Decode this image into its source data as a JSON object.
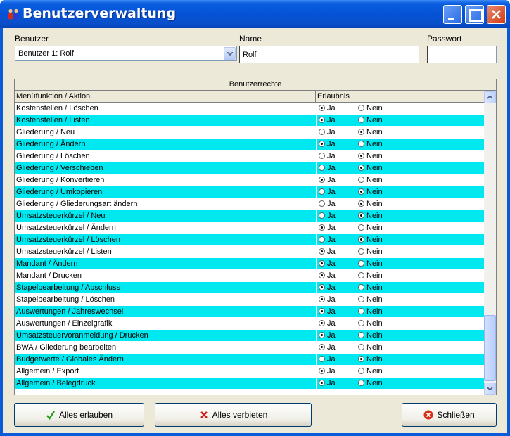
{
  "window": {
    "title": "Benutzerverwaltung"
  },
  "fields": {
    "user_label": "Benutzer",
    "user_value": "Benutzer 1: Rolf",
    "name_label": "Name",
    "name_value": "Rolf",
    "password_label": "Passwort",
    "password_value": ""
  },
  "grid": {
    "caption": "Benutzerrechte",
    "col_function": "Menüfunktion / Aktion",
    "col_permission": "Erlaubnis",
    "yes_label": "Ja",
    "no_label": "Nein",
    "rows": [
      {
        "label": "Kostenstellen / Löschen",
        "allowed": true
      },
      {
        "label": "Kostenstellen / Listen",
        "allowed": true
      },
      {
        "label": "Gliederung / Neu",
        "allowed": false
      },
      {
        "label": "Gliederung / Ändern",
        "allowed": true
      },
      {
        "label": "Gliederung / Löschen",
        "allowed": false
      },
      {
        "label": "Gliederung / Verschieben",
        "allowed": false
      },
      {
        "label": "Gliederung / Konvertieren",
        "allowed": true
      },
      {
        "label": "Gliederung / Umkopieren",
        "allowed": false
      },
      {
        "label": "Gliederung / Gliederungsart ändern",
        "allowed": false
      },
      {
        "label": "Umsatzsteuerkürzel / Neu",
        "allowed": false
      },
      {
        "label": "Umsatzsteuerkürzel / Ändern",
        "allowed": true
      },
      {
        "label": "Umsatzsteuerkürzel / Löschen",
        "allowed": false
      },
      {
        "label": "Umsatzsteuerkürzel / Listen",
        "allowed": true
      },
      {
        "label": "Mandant / Ändern",
        "allowed": true
      },
      {
        "label": "Mandant / Drucken",
        "allowed": true
      },
      {
        "label": "Stapelbearbeitung / Abschluss",
        "allowed": true
      },
      {
        "label": "Stapelbearbeitung / Löschen",
        "allowed": true
      },
      {
        "label": "Auswertungen / Jahreswechsel",
        "allowed": true
      },
      {
        "label": "Auswertungen / Einzelgrafik",
        "allowed": true
      },
      {
        "label": "Umsatzsteuervoranmeldung / Drucken",
        "allowed": true
      },
      {
        "label": "BWA / Gliederung bearbeiten",
        "allowed": true
      },
      {
        "label": "Budgetwerte / Globales Ändern",
        "allowed": false
      },
      {
        "label": "Allgemein / Export",
        "allowed": true
      },
      {
        "label": "Allgemein / Belegdruck",
        "allowed": true
      }
    ]
  },
  "buttons": {
    "allow_all": "Alles erlauben",
    "deny_all": "Alles verbieten",
    "close": "Schließen"
  },
  "colors": {
    "highlight_row": "#00e8ef",
    "title_bar": "#0553d6",
    "client_bg": "#ece9d8"
  }
}
